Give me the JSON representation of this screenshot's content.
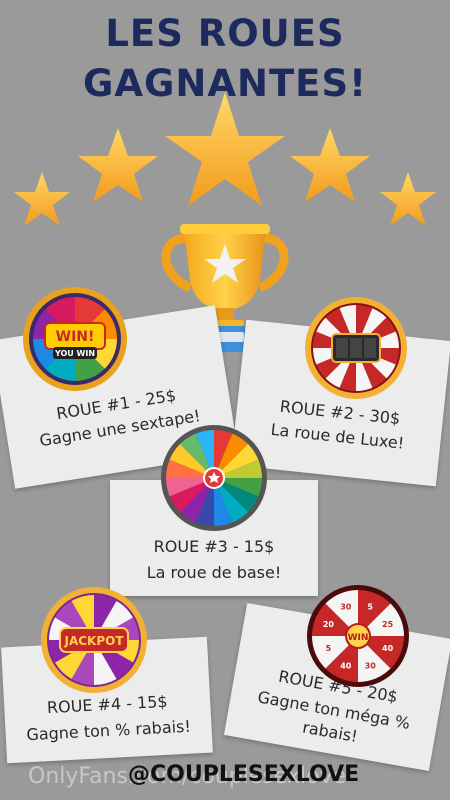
{
  "title": {
    "line1": "LES ROUES",
    "line2": "GAGNANTES!"
  },
  "colors": {
    "background": "#9a9a9a",
    "title": "#1c2a5e",
    "star": "#f7b733",
    "card": "#ececec"
  },
  "wheels": [
    {
      "id": 1,
      "line1": "ROUE #1 - 25$",
      "line2": "Gagne une sextape!",
      "badge": "WIN!",
      "badge_sub": "YOU WIN"
    },
    {
      "id": 2,
      "line1": "ROUE #2 - 30$",
      "line2": "La roue de Luxe!"
    },
    {
      "id": 3,
      "line1": "ROUE #3 - 15$",
      "line2": "La roue de base!"
    },
    {
      "id": 4,
      "line1": "ROUE #4 - 15$",
      "line2": "Gagne ton % rabais!",
      "badge": "JACKPOT"
    },
    {
      "id": 5,
      "line1": "ROUE #5 - 20$",
      "line2": "Gagne ton méga %",
      "line3": "rabais!",
      "badge": "WIN"
    }
  ],
  "wheel5_numbers": [
    "5",
    "25",
    "40",
    "30",
    "40",
    "5",
    "20",
    "30"
  ],
  "footer": {
    "watermark": "OnlyFans.com/couplesexlove",
    "handle": "@COUPLESEXLOVE"
  }
}
